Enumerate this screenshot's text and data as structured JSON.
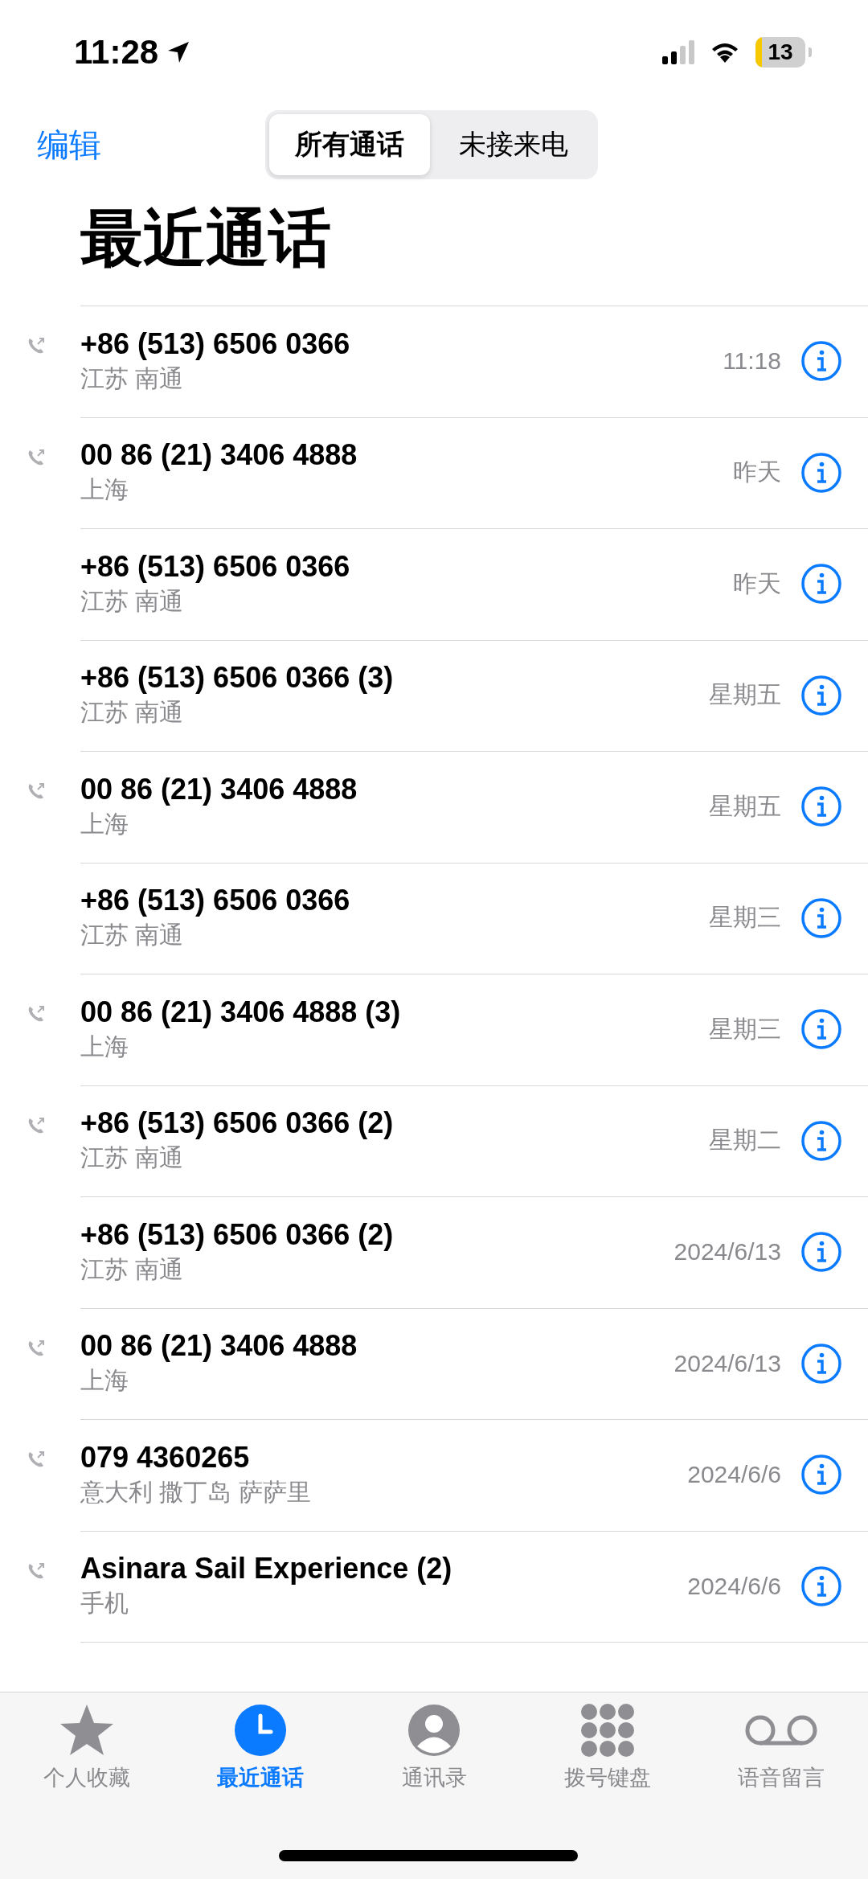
{
  "status_bar": {
    "time": "11:28",
    "battery": "13"
  },
  "nav": {
    "edit": "编辑",
    "segments": [
      {
        "label": "所有通话",
        "selected": true
      },
      {
        "label": "未接来电",
        "selected": false
      }
    ]
  },
  "title": "最近通话",
  "calls": [
    {
      "name": "+86 (513) 6506 0366",
      "detail": "江苏 南通",
      "when": "11:18",
      "outgoing": true
    },
    {
      "name": "00 86 (21) 3406 4888",
      "detail": "上海",
      "when": "昨天",
      "outgoing": true
    },
    {
      "name": "+86 (513) 6506 0366",
      "detail": "江苏 南通",
      "when": "昨天",
      "outgoing": false
    },
    {
      "name": "+86 (513) 6506 0366 (3)",
      "detail": "江苏 南通",
      "when": "星期五",
      "outgoing": false
    },
    {
      "name": "00 86 (21) 3406 4888",
      "detail": "上海",
      "when": "星期五",
      "outgoing": true
    },
    {
      "name": "+86 (513) 6506 0366",
      "detail": "江苏 南通",
      "when": "星期三",
      "outgoing": false
    },
    {
      "name": "00 86 (21) 3406 4888 (3)",
      "detail": "上海",
      "when": "星期三",
      "outgoing": true
    },
    {
      "name": "+86 (513) 6506 0366 (2)",
      "detail": "江苏 南通",
      "when": "星期二",
      "outgoing": true
    },
    {
      "name": "+86 (513) 6506 0366 (2)",
      "detail": "江苏 南通",
      "when": "2024/6/13",
      "outgoing": false
    },
    {
      "name": "00 86 (21) 3406 4888",
      "detail": "上海",
      "when": "2024/6/13",
      "outgoing": true
    },
    {
      "name": "079 4360265",
      "detail": "意大利 撒丁岛 萨萨里",
      "when": "2024/6/6",
      "outgoing": true
    },
    {
      "name": "Asinara Sail Experience (2)",
      "detail": "手机",
      "when": "2024/6/6",
      "outgoing": true
    }
  ],
  "tab_bar": [
    {
      "kind": "star",
      "label": "个人收藏",
      "selected": false
    },
    {
      "kind": "clock",
      "label": "最近通话",
      "selected": true
    },
    {
      "kind": "person",
      "label": "通讯录",
      "selected": false
    },
    {
      "kind": "keypad",
      "label": "拨号键盘",
      "selected": false
    },
    {
      "kind": "voicemail",
      "label": "语音留言",
      "selected": false
    }
  ]
}
